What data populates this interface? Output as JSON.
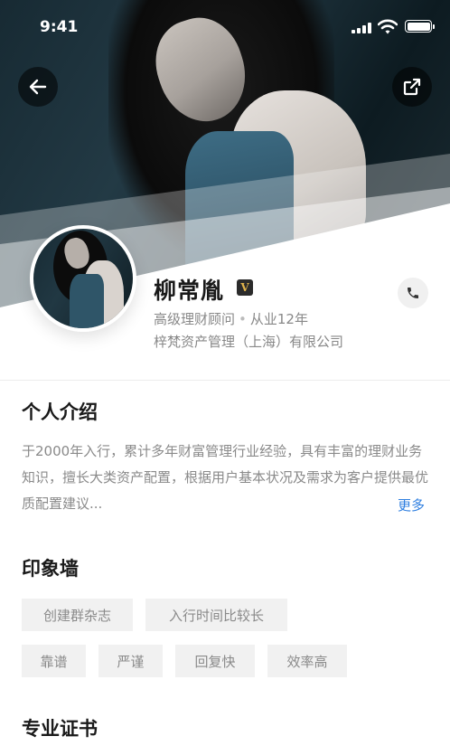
{
  "status_bar": {
    "time": "9:41"
  },
  "header": {
    "back_icon": "arrow-left-icon",
    "share_icon": "share-external-icon"
  },
  "profile": {
    "name": "柳常胤",
    "badge": "V",
    "title": "高级理财顾问",
    "experience": "从业12年",
    "separator": "•",
    "company": "梓梵资产管理（上海）有限公司",
    "phone_icon": "phone-icon"
  },
  "intro": {
    "title": "个人介绍",
    "text": "于2000年入行，累计多年财富管理行业经验，具有丰富的理财业务知识，擅长大类资产配置，根据用户基本状况及需求为客户提供最优质配置建议...",
    "more": "更多"
  },
  "impression_wall": {
    "title": "印象墙",
    "tags": [
      "创建群杂志",
      "入行时间比较长",
      "靠谱",
      "严谨",
      "回复快",
      "效率高"
    ]
  },
  "certificates": {
    "title": "专业证书"
  },
  "colors": {
    "accent": "#2f7fe0",
    "badge_gold": "#e2b54c"
  }
}
